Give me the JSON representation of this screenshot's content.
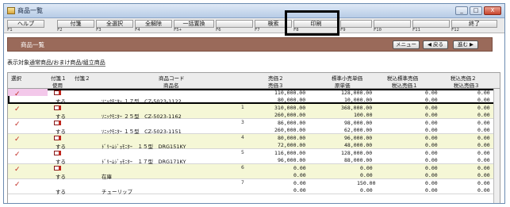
{
  "window": {
    "title": "商品一覧",
    "controls": [
      "_",
      "□",
      "X"
    ]
  },
  "fkeys": [
    {
      "label": "ヘルプ",
      "num": "F1"
    },
    {
      "label": "付箋",
      "num": "F2"
    },
    {
      "label": "全選択",
      "num": "F3"
    },
    {
      "label": "全解除",
      "num": "F4"
    },
    {
      "label": "一括置換",
      "num": "F5+"
    },
    {
      "label": "",
      "num": "F6"
    },
    {
      "label": "検索",
      "num": "F7"
    },
    {
      "label": "印刷",
      "num": "F8"
    },
    {
      "label": "",
      "num": "F9"
    },
    {
      "label": "",
      "num": "F10"
    },
    {
      "label": "",
      "num": "F11"
    },
    {
      "label": "終了",
      "num": "F12"
    }
  ],
  "header": {
    "title": "商品一覧",
    "menu_label": "メニュー",
    "back_label": "◀ 戻る",
    "next_label": "進む ▶"
  },
  "filter": {
    "label": "表示対象",
    "value": "通常商品/おまけ商品/組立商品"
  },
  "grid": {
    "headers_top": [
      "選択",
      "付箋１",
      "付箋２",
      "商品コード",
      "売価２",
      "標準小売単価",
      "税込標準売価",
      "税込売価２"
    ],
    "headers_bottom": [
      "使用",
      "商品名",
      "売価３",
      "原単価",
      "税込売価１",
      "税込売価３"
    ],
    "rows": [
      {
        "num": "1",
        "check": "✓",
        "use": "する",
        "code": "",
        "name": "ｿﾆｯｸﾓﾆﾀｰ １７型　CZ-5023-1122",
        "a1": "110,000.00",
        "a2": "80,000.00",
        "b1": "128,000.00",
        "b2": "10,000.00",
        "c1": "0.00",
        "c2": "0.00",
        "d1": "0.00",
        "d2": "0.00"
      },
      {
        "num": "2",
        "check": "✓",
        "use": "する",
        "code": "",
        "name": "ｿﾆｯｸﾓﾆﾀｰ ２５型　CZ-5023-1162",
        "a1": "310,000.00",
        "a2": "260,000.00",
        "b1": "368,000.00",
        "b2": "100.00",
        "c1": "0.00",
        "c2": "0.00",
        "d1": "0.00",
        "d2": "0.00"
      },
      {
        "num": "3",
        "check": "✓",
        "use": "する",
        "code": "",
        "name": "ｿﾆｯｸﾓﾆﾀｰ １５型　CZ-5023-1151",
        "a1": "86,000.00",
        "a2": "260,000.00",
        "b1": "98,000.00",
        "b2": "62,000.00",
        "c1": "0.00",
        "c2": "0.00",
        "d1": "0.00",
        "d2": "0.00"
      },
      {
        "num": "4",
        "check": "✓",
        "use": "する",
        "code": "",
        "name": "ﾄﾞﾘｰﾑｼﾞｮﾓﾆﾀｰ　１５型　DRG151KY",
        "a1": "80,000.00",
        "a2": "72,000.00",
        "b1": "96,000.00",
        "b2": "48,000.00",
        "c1": "0.00",
        "c2": "0.00",
        "d1": "0.00",
        "d2": "0.00"
      },
      {
        "num": "5",
        "check": "✓",
        "use": "する",
        "code": "",
        "name": "ﾄﾞﾘｰﾑｼﾞｮﾓﾆﾀｰ　１７型　DRG171KY",
        "a1": "116,000.00",
        "a2": "96,000.00",
        "b1": "128,000.00",
        "b2": "88,000.00",
        "c1": "0.00",
        "c2": "0.00",
        "d1": "0.00",
        "d2": "0.00"
      },
      {
        "num": "6",
        "check": "✓",
        "use": "する",
        "code": "",
        "name": "在庫",
        "a1": "0.00",
        "a2": "0.00",
        "b1": "0.00",
        "b2": "0.00",
        "c1": "0.00",
        "c2": "0.00",
        "d1": "0.00",
        "d2": "0.00"
      },
      {
        "num": "7",
        "check": "✓",
        "use": "する",
        "code": "",
        "name": "チューリップ",
        "a1": "0.00",
        "a2": "0.00",
        "b1": "150.00",
        "b2": "0.00",
        "c1": "0.00",
        "c2": "0.00",
        "d1": "0.00",
        "d2": "0.00"
      }
    ]
  }
}
